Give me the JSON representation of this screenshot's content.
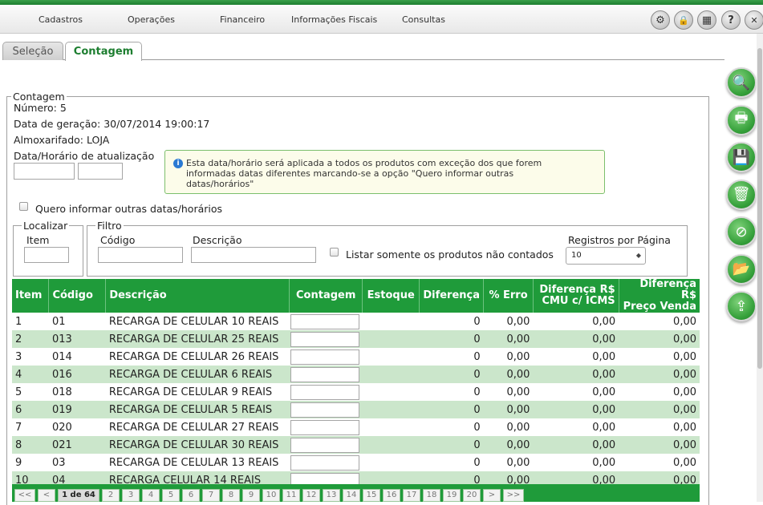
{
  "menu": [
    "Cadastros",
    "Operações",
    "Financeiro",
    "Informações Fiscais",
    "Consultas"
  ],
  "tools": [
    {
      "icon": "gear-icon",
      "glyph": "⚙"
    },
    {
      "icon": "lock-icon",
      "glyph": "🔒"
    },
    {
      "icon": "calculator-icon",
      "glyph": "▦"
    },
    {
      "icon": "help-icon",
      "glyph": "?"
    },
    {
      "icon": "close-icon",
      "glyph": "✕"
    }
  ],
  "tabs": {
    "selecao": "Seleção",
    "contagem": "Contagem"
  },
  "contagem": {
    "legend": "Contagem",
    "numero": "Número: 5",
    "data_geracao": "Data de geração: 30/07/2014 19:00:17",
    "almoxarifado": "Almoxarifado: LOJA",
    "data_horario_label": "Data/Horário de atualização",
    "data_value": "",
    "hora_value": "",
    "notice": "Esta data/horário será aplicada a todos os produtos com exceção dos que forem\ninformadas datas diferentes marcando-se a opção \"Quero informar outras\ndatas/horários\"",
    "outras_datas_label": "Quero informar outras datas/horários"
  },
  "localizar": {
    "legend": "Localizar",
    "item_label": "Item",
    "item_value": ""
  },
  "filtro": {
    "legend": "Filtro",
    "codigo_label": "Código",
    "descricao_label": "Descrição",
    "codigo_value": "",
    "descricao_value": "",
    "nao_contados_label": "Listar somente os produtos não contados",
    "registros_label": "Registros por Página",
    "registros_value": "10"
  },
  "table": {
    "headers": {
      "item": "Item",
      "codigo": "Código",
      "descricao": "Descrição",
      "contagem": "Contagem",
      "estoque": "Estoque",
      "diferenca": "Diferença",
      "erro": "% Erro",
      "dif_cmu_1": "Diferença R$",
      "dif_cmu_2": "CMU c/ ICMS",
      "dif_pv_1": "Diferença R$",
      "dif_pv_2": "Preço Venda"
    },
    "rows": [
      {
        "item": "1",
        "codigo": "01",
        "descricao": "RECARGA DE CELULAR 10 REAIS",
        "estoque": "",
        "diferenca": "0",
        "erro": "0,00",
        "cmu": "0,00",
        "pv": "0,00"
      },
      {
        "item": "2",
        "codigo": "013",
        "descricao": "RECARGA DE CELULAR 25 REAIS",
        "estoque": "",
        "diferenca": "0",
        "erro": "0,00",
        "cmu": "0,00",
        "pv": "0,00"
      },
      {
        "item": "3",
        "codigo": "014",
        "descricao": "RECARGA DE CELULAR 26 REAIS",
        "estoque": "",
        "diferenca": "0",
        "erro": "0,00",
        "cmu": "0,00",
        "pv": "0,00"
      },
      {
        "item": "4",
        "codigo": "016",
        "descricao": "RECARGA DE CELULAR 6 REAIS",
        "estoque": "",
        "diferenca": "0",
        "erro": "0,00",
        "cmu": "0,00",
        "pv": "0,00"
      },
      {
        "item": "5",
        "codigo": "018",
        "descricao": "RECARGA DE CELULAR 9 REAIS",
        "estoque": "",
        "diferenca": "0",
        "erro": "0,00",
        "cmu": "0,00",
        "pv": "0,00"
      },
      {
        "item": "6",
        "codigo": "019",
        "descricao": "RECARGA DE CELULAR 5 REAIS",
        "estoque": "",
        "diferenca": "0",
        "erro": "0,00",
        "cmu": "0,00",
        "pv": "0,00"
      },
      {
        "item": "7",
        "codigo": "020",
        "descricao": "RECARGA DE CELULAR 27 REAIS",
        "estoque": "",
        "diferenca": "0",
        "erro": "0,00",
        "cmu": "0,00",
        "pv": "0,00"
      },
      {
        "item": "8",
        "codigo": "021",
        "descricao": "RECARGA DE CELULAR 30 REAIS",
        "estoque": "",
        "diferenca": "0",
        "erro": "0,00",
        "cmu": "0,00",
        "pv": "0,00"
      },
      {
        "item": "9",
        "codigo": "03",
        "descricao": "RECARGA DE CELULAR 13 REAIS",
        "estoque": "",
        "diferenca": "0",
        "erro": "0,00",
        "cmu": "0,00",
        "pv": "0,00"
      },
      {
        "item": "10",
        "codigo": "04",
        "descricao": "RECARGA CELULAR 14 REAIS",
        "estoque": "",
        "diferenca": "0",
        "erro": "0,00",
        "cmu": "0,00",
        "pv": "0,00"
      }
    ]
  },
  "pager": {
    "first": "<<",
    "prev": "<",
    "current": "1 de 64",
    "next": ">",
    "last": ">>",
    "pages": [
      "2",
      "3",
      "4",
      "5",
      "6",
      "7",
      "8",
      "9",
      "10",
      "11",
      "12",
      "13",
      "14",
      "15",
      "16",
      "17",
      "18",
      "19",
      "20"
    ]
  },
  "side_actions": [
    {
      "name": "search",
      "icon": "search-icon",
      "glyph": "🔍"
    },
    {
      "name": "print",
      "icon": "printer-icon",
      "glyph": "🖶"
    },
    {
      "name": "save",
      "icon": "save-icon",
      "glyph": "💾"
    },
    {
      "name": "delete",
      "icon": "trash-icon",
      "glyph": "🗑"
    },
    {
      "name": "cancel",
      "icon": "cancel-icon",
      "glyph": "⊘"
    },
    {
      "name": "open",
      "icon": "folder-open-icon",
      "glyph": "📂"
    },
    {
      "name": "export",
      "icon": "export-icon",
      "glyph": "⇪"
    }
  ],
  "colors": {
    "accent": "#1f9b3a",
    "row_alt": "#cbe6cb"
  }
}
